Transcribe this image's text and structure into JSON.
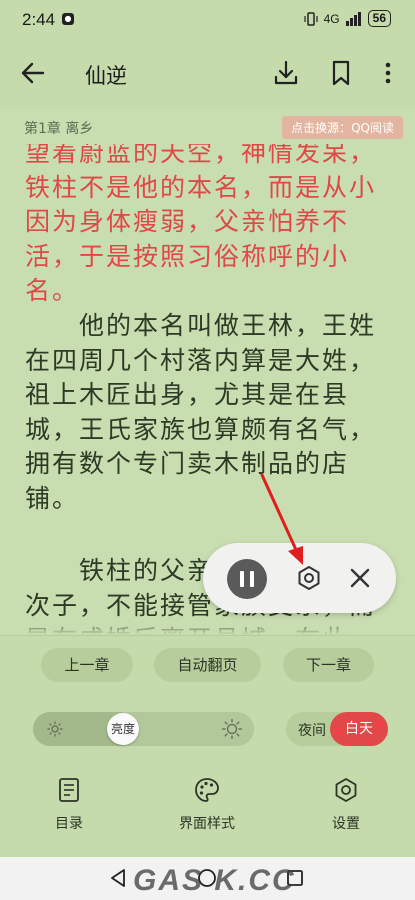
{
  "status_bar": {
    "time": "2:44",
    "network": "4G",
    "battery": "56"
  },
  "app_bar": {
    "title": "仙逆"
  },
  "chapter": {
    "label": "第1章 离乡",
    "source_button": "点击换源：QQ阅读"
  },
  "reader": {
    "paragraphs": [
      {
        "text": "望着蔚蓝的天空，神情发呆，铁柱不是他的本名，而是从小因为身体瘦弱，父亲怕养不活，于是按照习俗称呼的小名。",
        "highlighted": true
      },
      {
        "text": "他的本名叫做王林，王姓在四周几个村落内算是大姓，祖上木匠出身，尤其是在县城，王氏家族也算颇有名气，拥有数个专门卖木制品的店铺。",
        "highlighted": false
      },
      {
        "text": "铁柱的父亲是王氏家族的次子，不能接管家族支系，而是在成婚后离开县城，在此",
        "highlighted": false
      }
    ]
  },
  "tts_panel": {
    "state": "playing"
  },
  "controls": {
    "prev_chapter": "上一章",
    "auto_page": "自动翻页",
    "next_chapter": "下一章",
    "brightness_label": "亮度",
    "brightness_level": 0.33,
    "night": "夜间",
    "day": "白天"
  },
  "bottom_tabs": [
    {
      "label": "目录",
      "icon": "catalog-icon"
    },
    {
      "label": "界面样式",
      "icon": "palette-icon"
    },
    {
      "label": "设置",
      "icon": "settings-icon"
    }
  ],
  "watermark": "GAS K.CC",
  "colors": {
    "background": "#c8ddb0",
    "accent": "#e34848",
    "highlight_text": "#e04848"
  }
}
